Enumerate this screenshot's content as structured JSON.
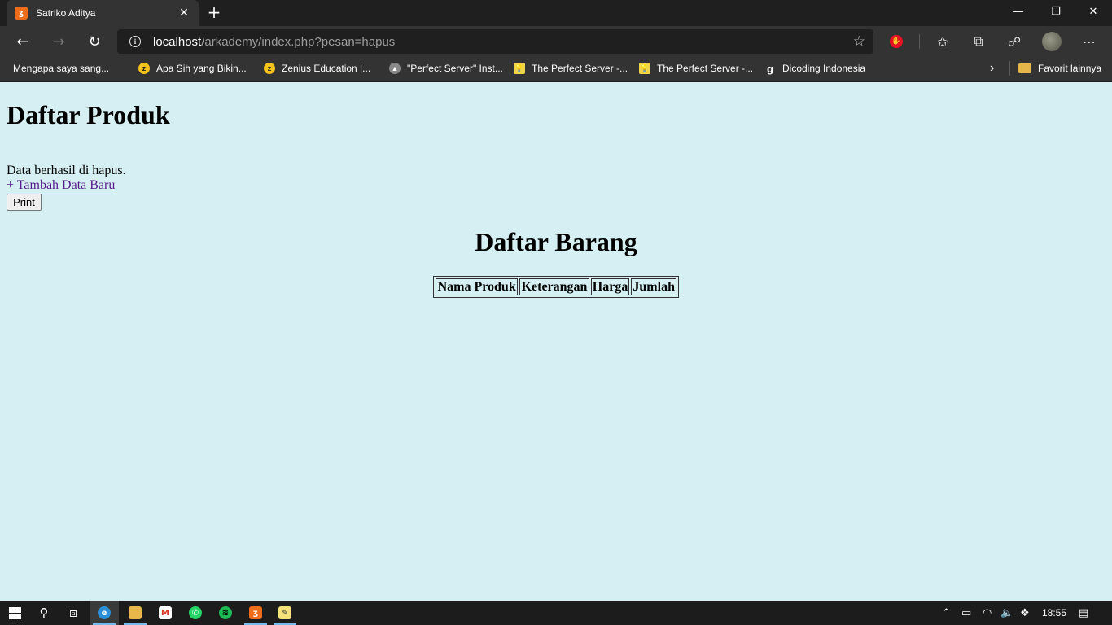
{
  "browser": {
    "tab_title": "Satriko Aditya",
    "tab_close": "✕",
    "new_tab": "+",
    "url_host": "localhost",
    "url_path": "/arkademy/index.php?pesan=hapus",
    "controls": {
      "minimize": "—",
      "restore": "❐",
      "close": "✕"
    },
    "bookmarks": [
      {
        "label": "Mengapa saya sang...",
        "icon": "page-icon"
      },
      {
        "label": "Apa Sih yang Bikin...",
        "icon": "zenius-icon"
      },
      {
        "label": "Zenius Education |...",
        "icon": "zenius-icon"
      },
      {
        "label": "\"Perfect Server\" Inst...",
        "icon": "server-icon"
      },
      {
        "label": "The Perfect Server -...",
        "icon": "bulb-icon"
      },
      {
        "label": "The Perfect Server -...",
        "icon": "bulb-icon"
      },
      {
        "label": "Dicoding Indonesia",
        "icon": "dicoding-icon"
      }
    ],
    "bookmarks_more": "›",
    "other_favorites": "Favorit lainnya"
  },
  "page": {
    "heading": "Daftar Produk",
    "message": "Data berhasil di hapus.",
    "add_link": "+ Tambah Data Baru",
    "print_button": "Print",
    "table_heading": "Daftar Barang",
    "columns": [
      "Nama Produk",
      "Keterangan",
      "Harga",
      "Jumlah"
    ]
  },
  "taskbar": {
    "clock": "18:55"
  },
  "colors": {
    "page_background": "#d6eff2",
    "link_visited": "#551a8b",
    "browser_chrome": "#333333",
    "taskbar": "#1c1c1c"
  }
}
